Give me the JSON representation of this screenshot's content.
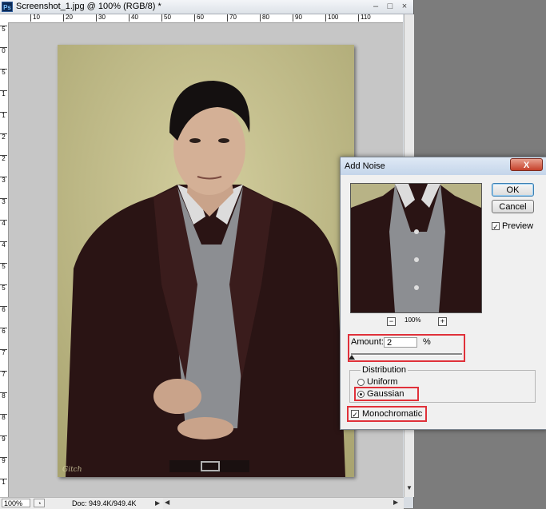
{
  "window": {
    "title": "Screenshot_1.jpg @ 100% (RGB/8) *",
    "app_icon": "Ps",
    "minimize": "–",
    "maximize": "□",
    "close": "×"
  },
  "ruler": {
    "h_ticks": [
      "10",
      "20",
      "30",
      "40",
      "50",
      "60",
      "70",
      "80",
      "90",
      "100",
      "110"
    ],
    "v_ticks": [
      "5",
      "0",
      "5",
      "1",
      "1",
      "2",
      "2",
      "3",
      "3",
      "4",
      "4",
      "5",
      "5",
      "6",
      "6",
      "7",
      "7",
      "8",
      "8",
      "9",
      "9",
      "1"
    ]
  },
  "photo": {
    "signature": "Gitch"
  },
  "status": {
    "zoom": "100%",
    "doc_info": "Doc: 949.4K/949.4K"
  },
  "dialog": {
    "title": "Add Noise",
    "close_label": "X",
    "ok_label": "OK",
    "cancel_label": "Cancel",
    "preview_label": "Preview",
    "preview_checked": true,
    "zoom_minus": "−",
    "zoom_plus": "+",
    "zoom_level": "100%",
    "amount_label": "Amount:",
    "amount_value": "2",
    "amount_unit": "%",
    "distribution_label": "Distribution",
    "uniform_label": "Uniform",
    "gaussian_label": "Gaussian",
    "selected_distribution": "Gaussian",
    "monochromatic_label": "Monochromatic",
    "monochromatic_checked": true
  },
  "colors": {
    "highlight": "#e0313a",
    "photo_background": "#c6c190",
    "jacket": "#2a1414",
    "shirt": "#8c8e92"
  }
}
